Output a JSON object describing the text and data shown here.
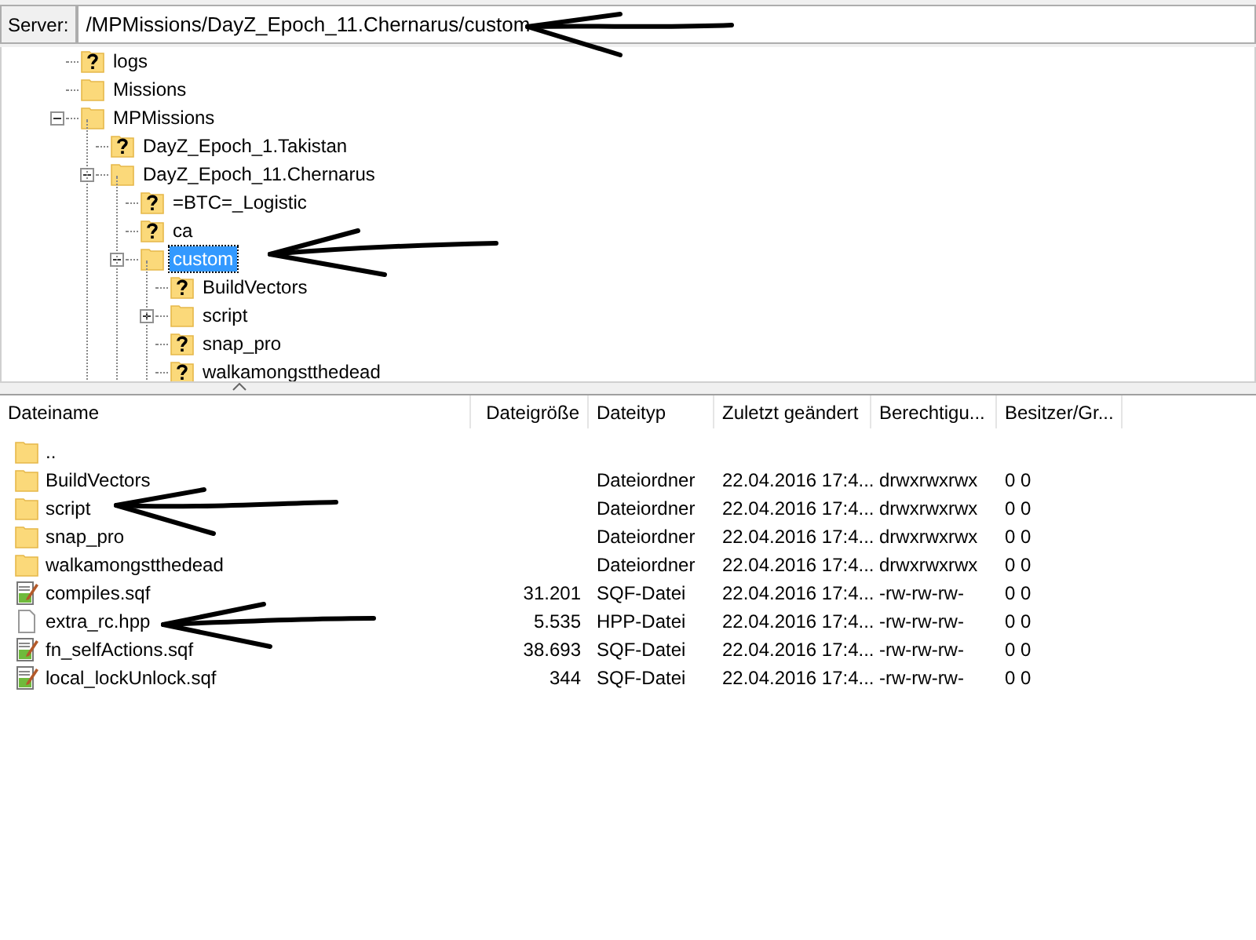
{
  "server_bar": {
    "label": "Server:",
    "path": "/MPMissions/DayZ_Epoch_11.Chernarus/custom"
  },
  "tree": [
    {
      "name": "logs",
      "kind": "unknown",
      "selected": false
    },
    {
      "name": "Missions",
      "kind": "folder",
      "selected": false
    },
    {
      "name": "MPMissions",
      "kind": "folder",
      "selected": false,
      "expanded": true,
      "children": [
        {
          "name": "DayZ_Epoch_1.Takistan",
          "kind": "unknown",
          "selected": false
        },
        {
          "name": "DayZ_Epoch_11.Chernarus",
          "kind": "folder",
          "selected": false,
          "expanded": true,
          "children": [
            {
              "name": "=BTC=_Logistic",
              "kind": "unknown",
              "selected": false
            },
            {
              "name": "ca",
              "kind": "unknown",
              "selected": false
            },
            {
              "name": "custom",
              "kind": "folder",
              "selected": true,
              "expanded": true,
              "children": [
                {
                  "name": "BuildVectors",
                  "kind": "unknown",
                  "selected": false
                },
                {
                  "name": "script",
                  "kind": "folder",
                  "selected": false,
                  "expanded": false
                },
                {
                  "name": "snap_pro",
                  "kind": "unknown",
                  "selected": false
                },
                {
                  "name": "walkamongstthedead",
                  "kind": "unknown",
                  "selected": false
                }
              ]
            }
          ]
        }
      ]
    }
  ],
  "file_list": {
    "columns": [
      "Dateiname",
      "Dateigröße",
      "Dateityp",
      "Zuletzt geändert",
      "Berechtigu...",
      "Besitzer/Gr..."
    ],
    "rows": [
      {
        "kind": "folder",
        "name": "..",
        "size": "",
        "type": "",
        "modified": "",
        "permissions": "",
        "owner": ""
      },
      {
        "kind": "folder",
        "name": "BuildVectors",
        "size": "",
        "type": "Dateiordner",
        "modified": "22.04.2016 17:4...",
        "permissions": "drwxrwxrwx",
        "owner": "0 0"
      },
      {
        "kind": "folder",
        "name": "script",
        "size": "",
        "type": "Dateiordner",
        "modified": "22.04.2016 17:4...",
        "permissions": "drwxrwxrwx",
        "owner": "0 0"
      },
      {
        "kind": "folder",
        "name": "snap_pro",
        "size": "",
        "type": "Dateiordner",
        "modified": "22.04.2016 17:4...",
        "permissions": "drwxrwxrwx",
        "owner": "0 0"
      },
      {
        "kind": "folder",
        "name": "walkamongstthedead",
        "size": "",
        "type": "Dateiordner",
        "modified": "22.04.2016 17:4...",
        "permissions": "drwxrwxrwx",
        "owner": "0 0"
      },
      {
        "kind": "script",
        "name": "compiles.sqf",
        "size": "31.201",
        "type": "SQF-Datei",
        "modified": "22.04.2016 17:4...",
        "permissions": "-rw-rw-rw-",
        "owner": "0 0"
      },
      {
        "kind": "file",
        "name": "extra_rc.hpp",
        "size": "5.535",
        "type": "HPP-Datei",
        "modified": "22.04.2016 17:4...",
        "permissions": "-rw-rw-rw-",
        "owner": "0 0"
      },
      {
        "kind": "script",
        "name": "fn_selfActions.sqf",
        "size": "38.693",
        "type": "SQF-Datei",
        "modified": "22.04.2016 17:4...",
        "permissions": "-rw-rw-rw-",
        "owner": "0 0"
      },
      {
        "kind": "script",
        "name": "local_lockUnlock.sqf",
        "size": "344",
        "type": "SQF-Datei",
        "modified": "22.04.2016 17:4...",
        "permissions": "-rw-rw-rw-",
        "owner": "0 0"
      }
    ]
  }
}
